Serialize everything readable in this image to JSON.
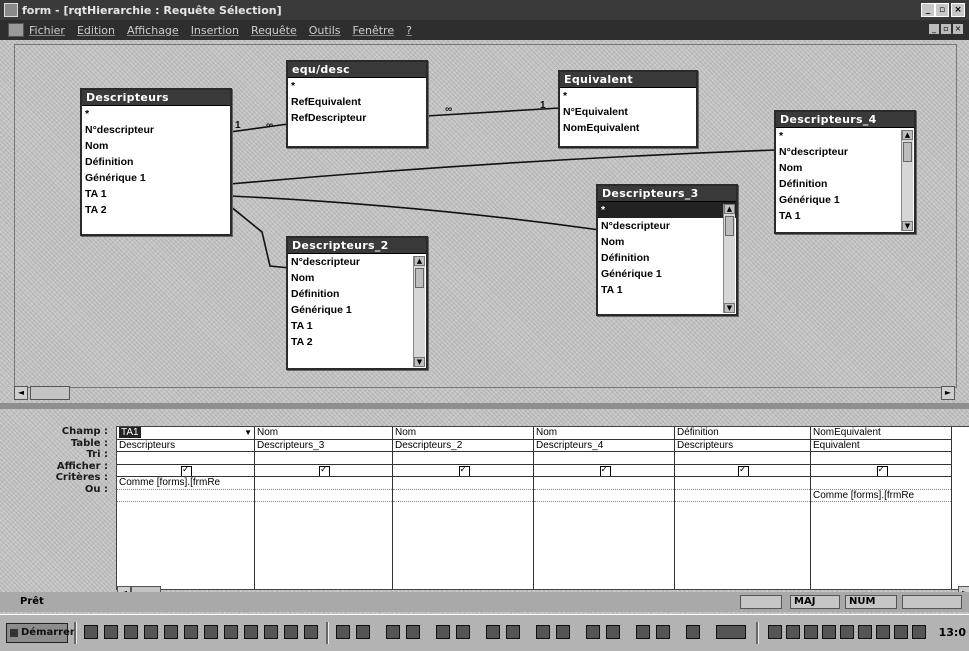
{
  "window": {
    "title": "form - [rqtHierarchie : Requête Sélection]",
    "controls": [
      "_",
      "▫",
      "×"
    ]
  },
  "menu": {
    "items": [
      "Fichier",
      "Edition",
      "Affichage",
      "Insertion",
      "Requête",
      "Outils",
      "Fenêtre",
      "?"
    ],
    "mdi_controls": [
      "_",
      "▫",
      "×"
    ]
  },
  "tables": [
    {
      "id": "t-descripteurs",
      "title": "Descripteurs",
      "fields": [
        "*",
        "N°descripteur",
        "Nom",
        "Définition",
        "Générique 1",
        "TA 1",
        "TA 2"
      ]
    },
    {
      "id": "t-equdesc",
      "title": "equ/desc",
      "fields": [
        "*",
        "RefEquivalent",
        "RefDescripteur"
      ]
    },
    {
      "id": "t-equivalent",
      "title": "Equivalent",
      "fields": [
        "*",
        "N°Equivalent",
        "NomEquivalent"
      ]
    },
    {
      "id": "t-descripteurs4",
      "title": "Descripteurs_4",
      "fields": [
        "*",
        "N°descripteur",
        "Nom",
        "Définition",
        "Générique 1",
        "TA 1"
      ]
    },
    {
      "id": "t-descripteurs3",
      "title": "Descripteurs_3",
      "fields": [
        "*",
        "N°descripteur",
        "Nom",
        "Définition",
        "Générique 1",
        "TA 1"
      ]
    },
    {
      "id": "t-descripteurs2",
      "title": "Descripteurs_2",
      "fields": [
        "N°descripteur",
        "Nom",
        "Définition",
        "Générique 1",
        "TA 1",
        "TA 2"
      ]
    }
  ],
  "joins": {
    "labels": {
      "one": "1",
      "many": "∞"
    }
  },
  "grid": {
    "row_labels": [
      "Champ :",
      "Table :",
      "Tri :",
      "Afficher :",
      "Critères :",
      "Ou :"
    ],
    "columns": [
      {
        "field": "TA1",
        "table": "Descripteurs",
        "sort": "",
        "show": true,
        "criteria": "Comme [forms].[frmRe",
        "or": ""
      },
      {
        "field": "Nom",
        "table": "Descripteurs_3",
        "sort": "",
        "show": true,
        "criteria": "",
        "or": ""
      },
      {
        "field": "Nom",
        "table": "Descripteurs_2",
        "sort": "",
        "show": true,
        "criteria": "",
        "or": ""
      },
      {
        "field": "Nom",
        "table": "Descripteurs_4",
        "sort": "",
        "show": true,
        "criteria": "",
        "or": ""
      },
      {
        "field": "Définition",
        "table": "Descripteurs",
        "sort": "",
        "show": true,
        "criteria": "",
        "or": ""
      },
      {
        "field": "NomEquivalent",
        "table": "Equivalent",
        "sort": "",
        "show": true,
        "criteria": "",
        "or": "Comme [forms].[frmRe"
      }
    ]
  },
  "status": {
    "left": "Prêt",
    "panels": [
      "",
      "MAJ",
      "NUM",
      ""
    ]
  },
  "taskbar": {
    "start": "Démarrer",
    "clock": "13:0"
  }
}
